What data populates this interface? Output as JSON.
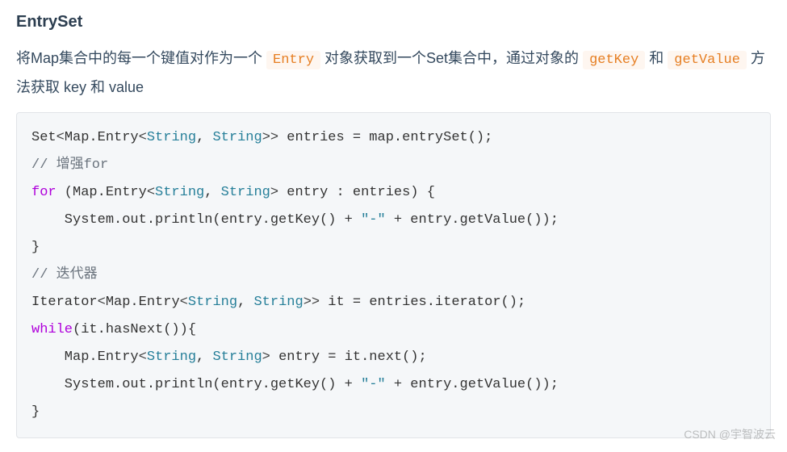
{
  "heading": "EntrySet",
  "description": {
    "part1": "将Map集合中的每一个键值对作为一个 ",
    "code1": "Entry",
    "part2": " 对象获取到一个Set集合中，通过对象的 ",
    "code2": "getKey",
    "part3": " 和 ",
    "code3": "getValue",
    "part4": " 方法获取 key 和 value"
  },
  "code": {
    "l1_a": "Set",
    "l1_b": "<",
    "l1_c": "Map.Entry",
    "l1_d": "<",
    "l1_e": "String",
    "l1_f": ", ",
    "l1_g": "String",
    "l1_h": ">>",
    "l1_i": " entries = map.entrySet();",
    "l2": "// 增强for",
    "l3_a": "for",
    "l3_b": " (Map.Entry",
    "l3_c": "<",
    "l3_d": "String",
    "l3_e": ", ",
    "l3_f": "String",
    "l3_g": ">",
    "l3_h": " entry : entries) {",
    "l4_a": "    System.out.println(entry.getKey() + ",
    "l4_b": "\"-\"",
    "l4_c": " + entry.getValue());",
    "l5": "}",
    "l6": "// 迭代器",
    "l7_a": "Iterator",
    "l7_b": "<",
    "l7_c": "Map.Entry",
    "l7_d": "<",
    "l7_e": "String",
    "l7_f": ", ",
    "l7_g": "String",
    "l7_h": ">>",
    "l7_i": " it = entries.iterator();",
    "l8_a": "while",
    "l8_b": "(it.hasNext()){",
    "l9_a": "    Map.Entry",
    "l9_b": "<",
    "l9_c": "String",
    "l9_d": ", ",
    "l9_e": "String",
    "l9_f": ">",
    "l9_g": " entry = it.next();",
    "l10_a": "    System.out.println(entry.getKey() + ",
    "l10_b": "\"-\"",
    "l10_c": " + entry.getValue());",
    "l11": "}"
  },
  "watermark": "CSDN @宇智波云"
}
